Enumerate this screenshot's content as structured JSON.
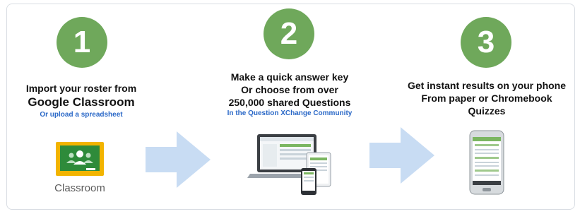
{
  "steps": [
    {
      "number": "1",
      "line1": "Import your roster from",
      "line2": "Google Classroom",
      "sub": "Or upload a spreadsheet",
      "icon": "google-classroom-logo",
      "icon_label": "Classroom"
    },
    {
      "number": "2",
      "line1": "Make a quick answer key",
      "line2": "Or choose from over",
      "line3": "250,000 shared Questions",
      "sub": "In the Question XChange Community",
      "icon": "devices-laptop-tablet-phone"
    },
    {
      "number": "3",
      "line1": "Get instant results on your phone",
      "line2": "From paper or Chromebook",
      "line3": "Quizzes",
      "icon": "smartphone-results"
    }
  ],
  "colors": {
    "circle": "#6fa85b",
    "arrow": "#c8dcf3",
    "sub_text": "#2a68c7",
    "classroom_green": "#2e8b3a",
    "classroom_frame": "#f2b400"
  }
}
